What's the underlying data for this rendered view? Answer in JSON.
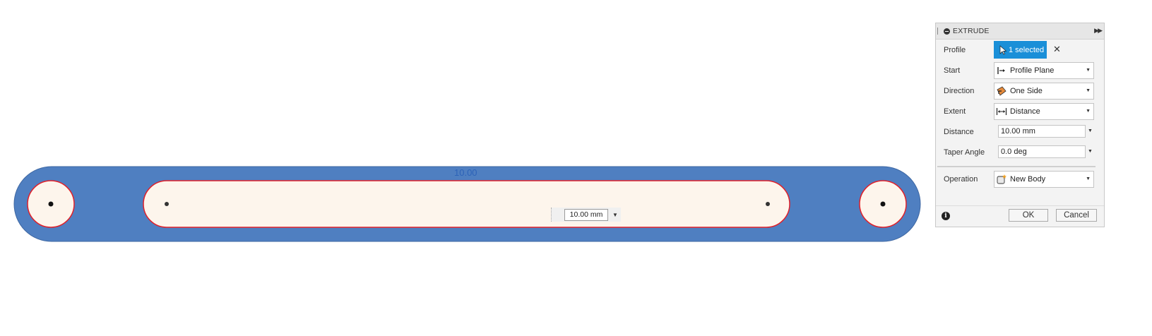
{
  "canvas": {
    "dimension_label": "10.00",
    "inline_distance_value": "10.00 mm",
    "colors": {
      "body_fill": "#4f7fc1",
      "profile_fill": "#fdf5ec",
      "profile_outline": "#e0202a"
    }
  },
  "panel": {
    "title": "EXTRUDE",
    "rows": {
      "profile": {
        "label": "Profile",
        "value": "1 selected"
      },
      "start": {
        "label": "Start",
        "value": "Profile Plane",
        "icon": "profile-plane-icon"
      },
      "direction": {
        "label": "Direction",
        "value": "One Side",
        "icon": "one-side-icon"
      },
      "extent": {
        "label": "Extent",
        "value": "Distance",
        "icon": "distance-icon"
      },
      "distance": {
        "label": "Distance",
        "value": "10.00 mm"
      },
      "taper": {
        "label": "Taper Angle",
        "value": "0.0 deg"
      },
      "operation": {
        "label": "Operation",
        "value": "New Body",
        "icon": "new-body-icon"
      }
    },
    "buttons": {
      "ok": "OK",
      "cancel": "Cancel"
    },
    "accent_color": "#1a8fd8"
  }
}
